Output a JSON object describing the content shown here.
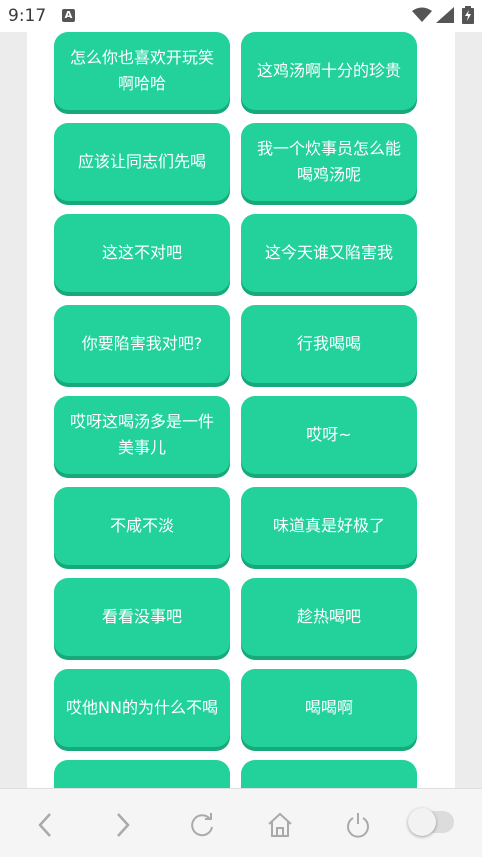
{
  "status_bar": {
    "time": "9:17",
    "notification_icon": "a-letter-icon",
    "icons": [
      "wifi-icon",
      "signal-icon",
      "battery-charging-icon"
    ]
  },
  "accent_color": "#22d29a",
  "phrases": [
    "怎么你也喜欢开玩笑啊哈哈",
    "这鸡汤啊十分的珍贵",
    "应该让同志们先喝",
    "我一个炊事员怎么能喝鸡汤呢",
    "这这不对吧",
    "这今天谁又陷害我",
    "你要陷害我对吧?",
    "行我喝喝",
    "哎呀这喝汤多是一件美事儿",
    "哎呀~",
    "不咸不淡",
    "味道真是好极了",
    "看看没事吧",
    "趁热喝吧",
    "哎他NN的为什么不喝",
    "喝喝啊",
    "",
    ""
  ],
  "bottom_nav": {
    "icons": [
      "back-icon",
      "forward-icon",
      "refresh-icon",
      "home-icon",
      "power-icon",
      "toggle-switch"
    ],
    "toggle_state": "off"
  }
}
